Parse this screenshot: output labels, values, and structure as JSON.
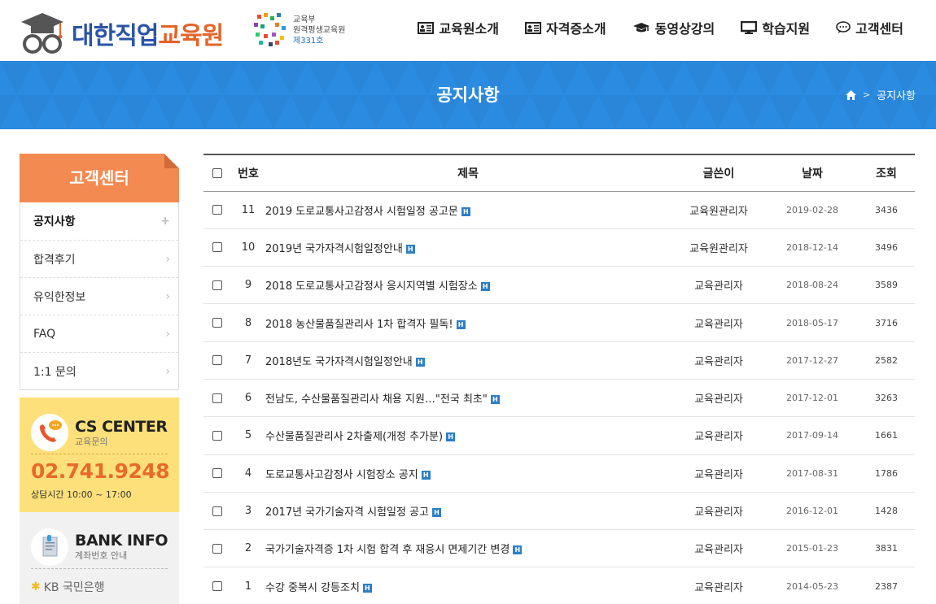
{
  "header": {
    "logo_main": "대한직업",
    "logo_accent": "교육원",
    "partner_line1": "교육부",
    "partner_line2": "원격평생교육원",
    "partner_line3": "제331호",
    "nav": [
      {
        "label": "교육원소개",
        "icon": "id-card-icon"
      },
      {
        "label": "자격증소개",
        "icon": "id-card-icon"
      },
      {
        "label": "동영상강의",
        "icon": "graduation-cap-icon"
      },
      {
        "label": "학습지원",
        "icon": "monitor-icon"
      },
      {
        "label": "고객센터",
        "icon": "chat-bubble-icon"
      }
    ]
  },
  "banner": {
    "title": "공지사항",
    "breadcrumb_current": "공지사항",
    "color": "#2f8fe1"
  },
  "sidebar": {
    "title": "고객센터",
    "items": [
      {
        "label": "공지사항",
        "active": true
      },
      {
        "label": "합격후기"
      },
      {
        "label": "유익한정보"
      },
      {
        "label": "FAQ"
      },
      {
        "label": "1:1 문의"
      }
    ],
    "cs": {
      "title": "CS CENTER",
      "subtitle": "교육문의",
      "phone": "02.741.9248",
      "hours_label": "상담시간",
      "hours": "10:00 ~ 17:00"
    },
    "bank": {
      "title": "BANK INFO",
      "subtitle": "계좌번호 안내",
      "bank_name": "KB 국민은행"
    }
  },
  "board": {
    "columns": {
      "no": "번호",
      "title": "제목",
      "author": "글쓴이",
      "date": "날짜",
      "views": "조회"
    },
    "rows": [
      {
        "no": "11",
        "title": "2019 도로교통사고감정사 시험일정 공고문",
        "author": "교육원관리자",
        "date": "2019-02-28",
        "views": "3436"
      },
      {
        "no": "10",
        "title": "2019년 국가자격시험일정안내",
        "author": "교육원관리자",
        "date": "2018-12-14",
        "views": "3496"
      },
      {
        "no": "9",
        "title": "2018 도로교통사고감정사 응시지역별 시험장소",
        "author": "교육관리자",
        "date": "2018-08-24",
        "views": "3589"
      },
      {
        "no": "8",
        "title": "2018 농산물품질관리사 1차 합격자 필독!",
        "author": "교육관리자",
        "date": "2018-05-17",
        "views": "3716"
      },
      {
        "no": "7",
        "title": "2018년도 국가자격시험일정안내",
        "author": "교육관리자",
        "date": "2017-12-27",
        "views": "2582"
      },
      {
        "no": "6",
        "title": "전남도, 수산물품질관리사 채용 지원…\"전국 최초\"",
        "author": "교육관리자",
        "date": "2017-12-01",
        "views": "3263"
      },
      {
        "no": "5",
        "title": "수산물품질관리사 2차출제(개정 추가분)",
        "author": "교육관리자",
        "date": "2017-09-14",
        "views": "1661"
      },
      {
        "no": "4",
        "title": "도로교통사고감정사 시험장소 공지",
        "author": "교육관리자",
        "date": "2017-08-31",
        "views": "1786"
      },
      {
        "no": "3",
        "title": "2017년 국가기술자격 시험일정 공고",
        "author": "교육관리자",
        "date": "2016-12-01",
        "views": "1428"
      },
      {
        "no": "2",
        "title": "국가기술자격증 1차 시험 합격 후 재응시 면제기간 변경",
        "author": "교육관리자",
        "date": "2015-01-23",
        "views": "3831"
      },
      {
        "no": "1",
        "title": "수강 중복시 강등조치",
        "author": "교육관리자",
        "date": "2014-05-23",
        "views": "2387"
      }
    ],
    "hot_badge": "H"
  }
}
